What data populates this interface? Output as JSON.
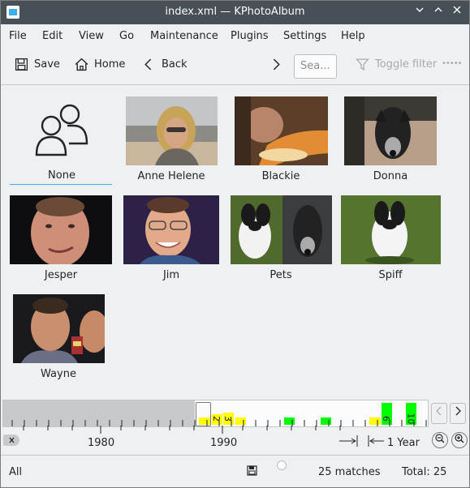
{
  "window": {
    "title": "index.xml — KPhotoAlbum"
  },
  "menubar": [
    "File",
    "Edit",
    "View",
    "Go",
    "Maintenance",
    "Plugins",
    "Settings",
    "Help"
  ],
  "toolbar": {
    "save_label": "Save",
    "home_label": "Home",
    "back_label": "Back",
    "search_placeholder": "Sea...",
    "toggle_filter_label": "Toggle filter",
    "more_label": "•••••"
  },
  "people": [
    {
      "name": "None",
      "icon": "people-icon"
    },
    {
      "name": "Anne Helene",
      "icon": "photo-anne-helene"
    },
    {
      "name": "Blackie",
      "icon": "photo-blackie"
    },
    {
      "name": "Donna",
      "icon": "photo-donna"
    },
    {
      "name": "Jesper",
      "icon": "photo-jesper"
    },
    {
      "name": "Jim",
      "icon": "photo-jim"
    },
    {
      "name": "Pets",
      "icon": "photo-pets"
    },
    {
      "name": "Spiff",
      "icon": "photo-spiff"
    },
    {
      "name": "Wayne",
      "icon": "photo-wayne"
    }
  ],
  "timeline": {
    "year_labels": [
      "1980",
      "1990"
    ],
    "bar_labels": [
      "2",
      "3",
      "6",
      "10"
    ],
    "range_label": "1 Year",
    "colors": {
      "yellow": "#ffff00",
      "green": "#00ff00",
      "gray": "#c8c9ca"
    }
  },
  "status": {
    "scope": "All",
    "matches": "25 matches",
    "total": "Total: 25"
  },
  "accent": "#3daee9"
}
